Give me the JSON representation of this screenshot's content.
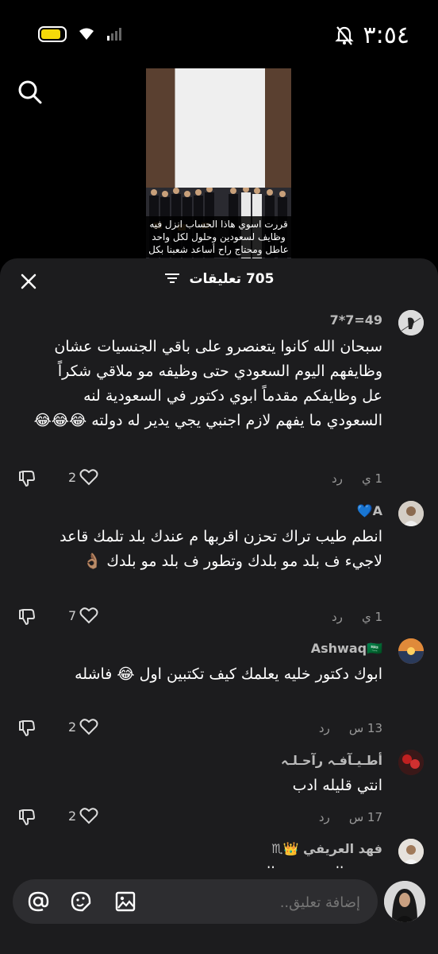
{
  "status": {
    "time": "٣:٥٤",
    "battery_color": "#f5d90a"
  },
  "video": {
    "caption": "قررت اسوي هاذا الحساب انزل فيه وظايف لسعودين وحلول لكل واحد عاطل ومحتاج راح أساعد شعبنا بكل"
  },
  "sheet": {
    "title": "705 تعليقات"
  },
  "comments": [
    {
      "user": "49=7*7",
      "text": "سبحان الله كانوا يتعنصرو على باقي الجنسيات عشان وظايفهم اليوم السعودي حتى وظيفه مو ملاقي شكراً عل وظايفكم مقدماً ابوي دكتور في السعودية لنه السعودي ما يفهم لازم اجنبي يجي يدير له دولته 😂😂😂",
      "time": "1 ي",
      "reply": "رد",
      "likes": "2"
    },
    {
      "user": "A💙",
      "text": "انطم طيب تراك تحزن اقربها م عندك بلد تلمك قاعد لاجيء ف بلد مو بلدك وتطور ف بلد مو بلدك 👌🏽",
      "time": "1 ي",
      "reply": "رد",
      "likes": "7"
    },
    {
      "user": "Ashwaq🇸🇦",
      "text": "ابوك دكتور خليه يعلمك كيف تكتبين اول 😂 فاشله",
      "time": "13 س",
      "reply": "رد",
      "likes": "2"
    },
    {
      "user": "أطـيـآفـہ رآحـلـہ",
      "text": "انتي قليله ادب",
      "time": "17 س",
      "reply": "رد",
      "likes": "2"
    },
    {
      "user": "فهد العريفي 👑♏",
      "text": "وقتت العيد شر خالد عنصر ب بهدوء",
      "time": "",
      "reply": "",
      "likes": ""
    }
  ],
  "composer": {
    "placeholder": "إضافة تعليق.."
  }
}
